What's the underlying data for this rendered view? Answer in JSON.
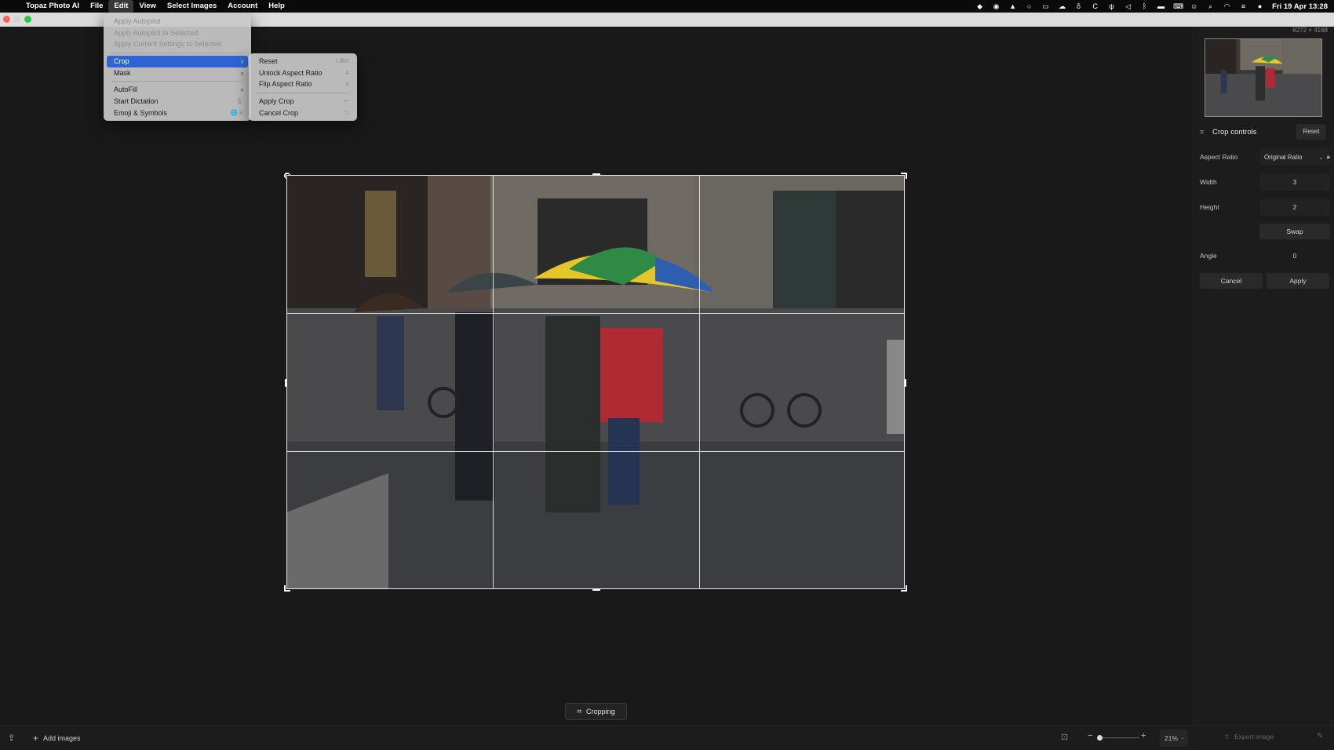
{
  "menubar": {
    "app_name": "Topaz Photo AI",
    "items": [
      "File",
      "Edit",
      "View",
      "Select Images",
      "Account",
      "Help"
    ],
    "active_item": "Edit",
    "clock": "Fri 19 Apr  13:28"
  },
  "window": {
    "resolution": "6272 × 4168"
  },
  "edit_menu": {
    "items": [
      {
        "label": "Apply Autopilot",
        "enabled": false
      },
      {
        "label": "Apply Autopilot to Selected",
        "enabled": false
      },
      {
        "label": "Apply Current Settings to Selected",
        "enabled": false
      },
      {
        "label": "Crop",
        "enabled": true,
        "submenu": true,
        "selected": true
      },
      {
        "label": "Mask",
        "enabled": true,
        "submenu": true
      },
      {
        "label": "AutoFill",
        "enabled": true,
        "submenu": true
      },
      {
        "label": "Start Dictation",
        "enabled": true,
        "shortcut": "🎙"
      },
      {
        "label": "Emoji & Symbols",
        "enabled": true,
        "shortcut": "🌐 E"
      }
    ]
  },
  "crop_submenu": {
    "items": [
      {
        "label": "Reset",
        "shortcut": "⇧⌘R"
      },
      {
        "label": "Unlock Aspect Ratio",
        "shortcut": "A"
      },
      {
        "label": "Flip Aspect Ratio",
        "shortcut": "X"
      },
      {
        "label": "Apply Crop",
        "shortcut": "↩"
      },
      {
        "label": "Cancel Crop",
        "shortcut": "⎋"
      }
    ]
  },
  "canvas": {
    "mode_badge": "Cropping"
  },
  "crop_panel": {
    "title": "Crop controls",
    "reset_label": "Reset",
    "aspect_ratio_label": "Aspect Ratio",
    "aspect_ratio_value": "Original Ratio",
    "width_label": "Width",
    "width_value": "3",
    "height_label": "Height",
    "height_value": "2",
    "swap_label": "Swap",
    "angle_label": "Angle",
    "angle_value": "0",
    "cancel_label": "Cancel",
    "apply_label": "Apply"
  },
  "bottombar": {
    "add_images_label": "Add images",
    "zoom_value": "21%",
    "export_label": "Export image"
  }
}
